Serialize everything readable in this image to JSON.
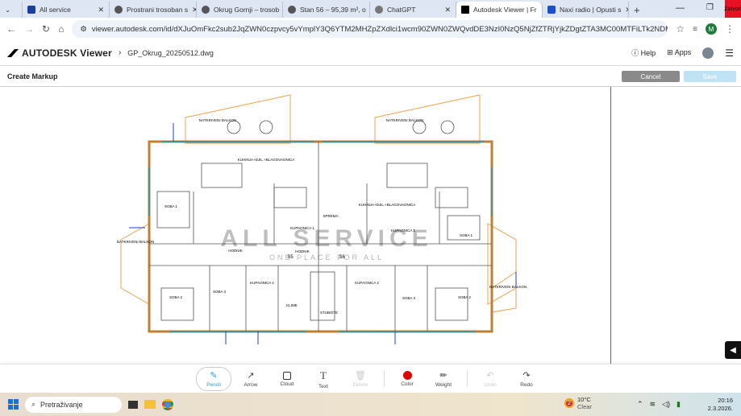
{
  "browser": {
    "tabs": [
      {
        "title": "All service",
        "active": false
      },
      {
        "title": "Prostrani trosoban s",
        "active": false
      },
      {
        "title": "Okrug Gornji – trosob",
        "active": false
      },
      {
        "title": "Stan 56 – 95,39 m², o",
        "active": false
      },
      {
        "title": "ChatGPT",
        "active": false
      },
      {
        "title": "Autodesk Viewer | Fr",
        "active": true
      },
      {
        "title": "Naxi radio | Opusti s",
        "active": false
      }
    ],
    "close_window_label": "Zatvori",
    "url": "viewer.autodesk.com/id/dXJuOmFkc2sub2JqZWN0czpvcy5vYmplY3Q6YTM2MHZpZXdlci1wcm90ZWN0ZWQvdDE3NzI0NzQ5NjZfZTRjYjkZDgtZTA3MC00MTFiLTk2NDMtNDcyNmNmZDAxZ...",
    "profile_initial": "M"
  },
  "app": {
    "logo": "AUTODESK Viewer",
    "file_name": "GP_Okrug_20250512.dwg",
    "help_label": "Help",
    "apps_label": "Apps",
    "markup_title": "Create Markup",
    "cancel_label": "Cancel",
    "save_label": "Save"
  },
  "drawing": {
    "watermark": "ALL SERVICE",
    "watermark_sub": "ONE PLACE FOR ALL",
    "rooms": [
      "KUHINJA+DJIL.+BLAGOVAONICA",
      "KUHINJA+DJIL.+BLAGOVAONICA",
      "SOBA 1",
      "SOBA 1",
      "SOBA 2",
      "SOBA 2",
      "SOBA 3",
      "SOBA 3",
      "HODNIK",
      "HODNIK",
      "KUPAONICA 1",
      "KUPAONICA 1",
      "KUPAONICA 2",
      "KUPAONICA 2",
      "NATKRIVENI BALKON",
      "NATKRIVENI BALKON",
      "NATKRIVENI BALKON",
      "NATKRIVENI BALKON",
      "SPREMA",
      "KLIME",
      "STUBIŠTE",
      "S5",
      "S6"
    ]
  },
  "toolbar": {
    "tools": [
      {
        "label": "Pencil",
        "icon": "pencil-icon",
        "state": "selected"
      },
      {
        "label": "Arrow",
        "icon": "arrow-icon",
        "state": "enabled"
      },
      {
        "label": "Cloud",
        "icon": "cloud-icon",
        "state": "enabled"
      },
      {
        "label": "Text",
        "icon": "text-icon",
        "state": "enabled"
      },
      {
        "label": "Delete",
        "icon": "trash-icon",
        "state": "disabled"
      },
      {
        "label": "Color",
        "icon": "color-icon",
        "state": "enabled"
      },
      {
        "label": "Weight",
        "icon": "weight-icon",
        "state": "enabled"
      },
      {
        "label": "Undo",
        "icon": "undo-icon",
        "state": "disabled"
      },
      {
        "label": "Redo",
        "icon": "redo-icon",
        "state": "enabled"
      }
    ],
    "color": "#e00000"
  },
  "taskbar": {
    "search_placeholder": "Pretraživanje",
    "weather_temp": "10°C",
    "weather_desc": "Clear",
    "weather_badge": "2",
    "time": "20:16",
    "date": "2.3.2026."
  },
  "colors": {
    "accent": "#1fa2d6",
    "save_bg": "#bfe3f3",
    "cancel_bg": "#8a8a8a"
  }
}
